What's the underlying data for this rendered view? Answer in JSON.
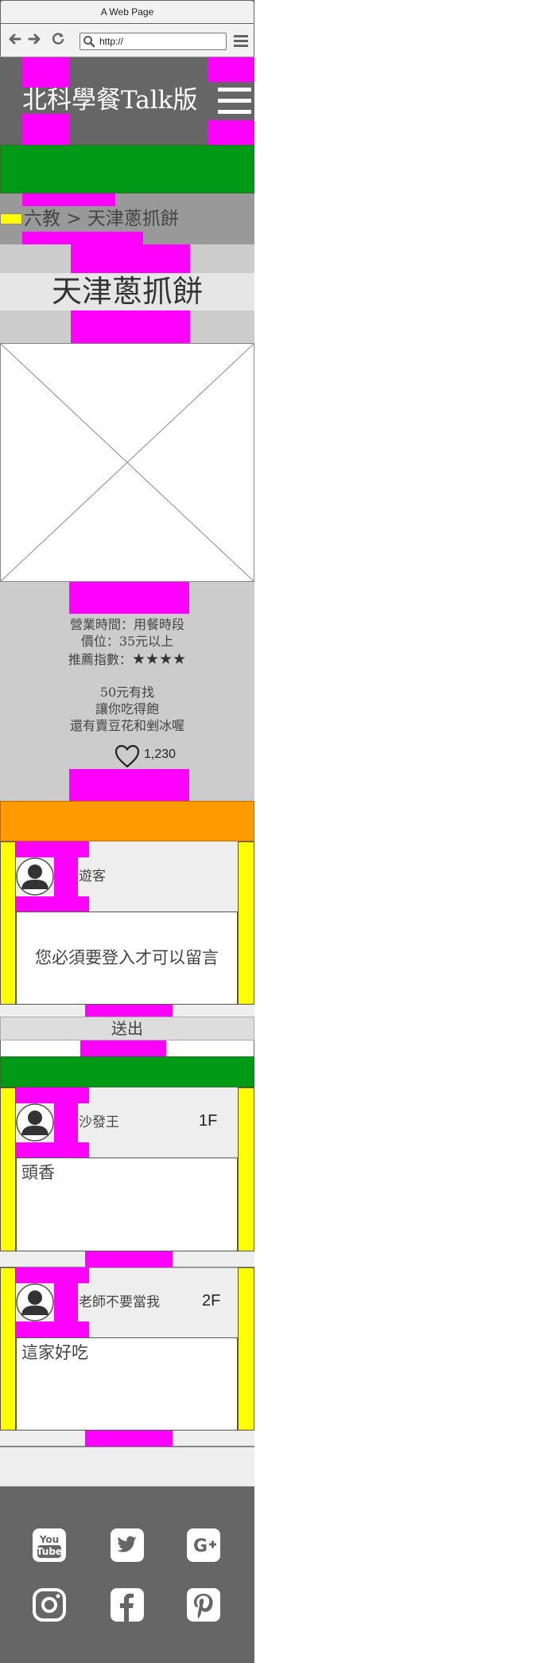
{
  "browser": {
    "title": "A Web Page",
    "url": "http://"
  },
  "header": {
    "site_title": "北科學餐Talk版"
  },
  "breadcrumb": {
    "parent": "六教",
    "separator": ">",
    "current": "天津蔥抓餅"
  },
  "page": {
    "title": "天津蔥抓餅"
  },
  "info": {
    "hours": "營業時間：用餐時段",
    "price": "價位：35元以上",
    "rating_label": "推薦指數：",
    "rating_stars": "★★★★",
    "rating_value": 4,
    "desc_line1": "50元有找",
    "desc_line2": "讓你吃得飽",
    "desc_line3": "還有賣豆花和剉冰喔",
    "likes": "1,230"
  },
  "comment_form": {
    "username": "遊客",
    "message": "您必須要登入才可以留言",
    "submit_label": "送出"
  },
  "comments": [
    {
      "user": "沙發王",
      "floor": "1F",
      "text": "頭香"
    },
    {
      "user": "老師不要當我",
      "floor": "2F",
      "text": "這家好吃"
    }
  ],
  "footer": {
    "social": [
      "youtube-icon",
      "twitter-icon",
      "google-plus-icon",
      "instagram-icon",
      "facebook-icon",
      "pinterest-icon"
    ]
  },
  "colors": {
    "placeholder_magenta": "#ff00ff",
    "placeholder_yellow": "#ffff00",
    "placeholder_green": "#009a17",
    "placeholder_orange": "#ff9a00",
    "header_bg": "#666666"
  }
}
